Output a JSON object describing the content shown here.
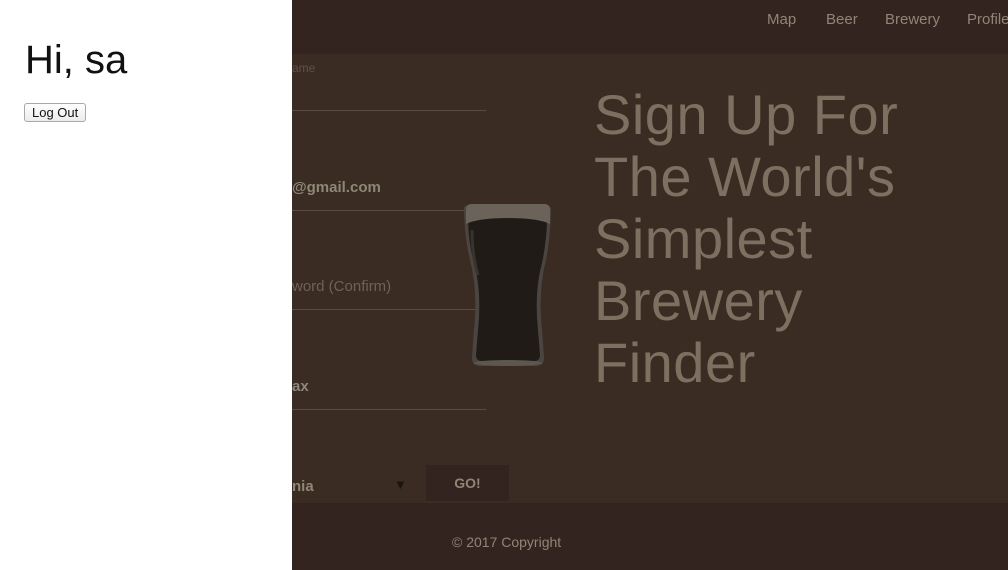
{
  "nav": {
    "items": [
      {
        "label": "Map"
      },
      {
        "label": "Beer"
      },
      {
        "label": "Brewery"
      },
      {
        "label": "Profile"
      }
    ]
  },
  "form": {
    "name_label": "ame",
    "email_value": "@gmail.com",
    "password_confirm_placeholder": "word (Confirm)",
    "city_value": "ax",
    "state_value": "nia",
    "go_label": "GO!"
  },
  "hero": {
    "lines": [
      "Sign Up For",
      "The World's",
      "Simplest",
      "Brewery",
      "Finder"
    ]
  },
  "footer": {
    "copyright": "© 2017 Copyright"
  },
  "side_panel": {
    "greeting": "Hi, sa",
    "logout_label": "Log Out"
  },
  "colors": {
    "background": "#3a2c23",
    "nav_background": "#33241f",
    "accent_text": "#7e7060",
    "panel": "#ffffff"
  },
  "icons": {
    "beer": "stout-pint-glass-icon",
    "dropdown": "triangle-down-icon"
  }
}
